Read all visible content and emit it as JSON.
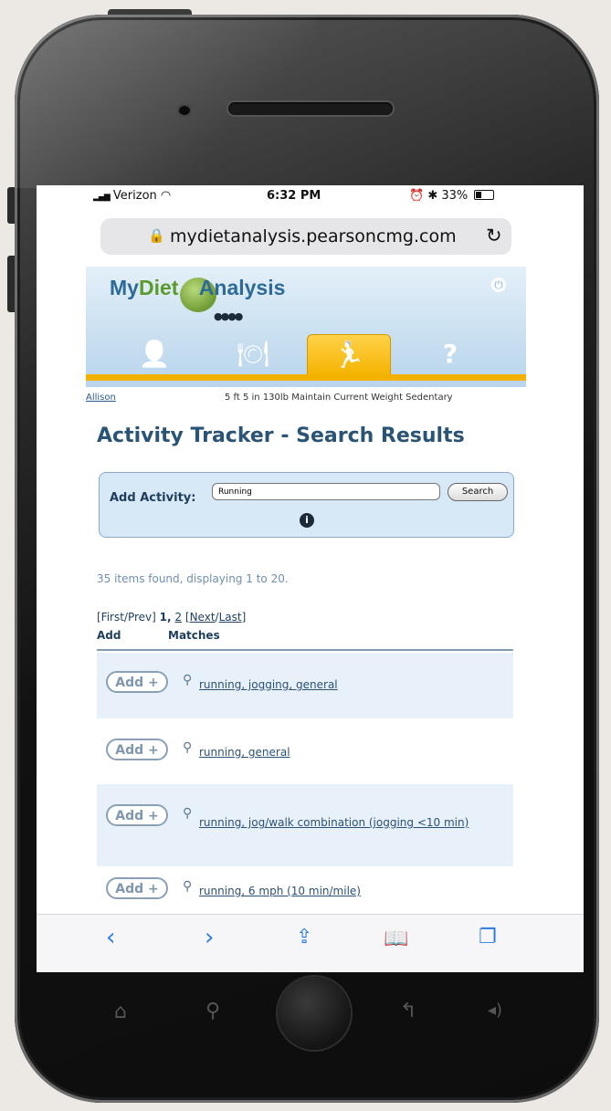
{
  "status_bar": {
    "carrier": "Verizon",
    "time": "6:32 PM",
    "battery": "33%"
  },
  "browser": {
    "url": "mydietanalysis.pearsoncmg.com"
  },
  "site": {
    "logo_my": "My",
    "logo_diet": "Diet",
    "logo_analysis": "Analysis",
    "tabs": [
      {
        "icon": "person-icon",
        "glyph": "👤"
      },
      {
        "icon": "plate-icon",
        "glyph": "🍽"
      },
      {
        "icon": "runner-icon",
        "glyph": "🏃"
      },
      {
        "icon": "help-icon",
        "glyph": "?"
      }
    ],
    "user_name": "Allison",
    "user_info": "5 ft 5 in  130lb  Maintain Current Weight  Sedentary"
  },
  "page": {
    "title": "Activity Tracker - Search Results",
    "add_activity_label": "Add Activity:",
    "search_value": "Running",
    "search_button": "Search",
    "items_found": "35 items found, displaying 1 to 20.",
    "pager": {
      "first_prev": "[First/Prev]",
      "page1": "1,",
      "page2": "2",
      "next": "Next",
      "last": "Last"
    },
    "col_add": "Add",
    "col_matches": "Matches",
    "add_label": "Add +",
    "results": [
      "running, jogging, general",
      "running, general",
      "running, jog/walk combination (jogging <10 min)",
      "running, 6 mph (10 min/mile)"
    ]
  },
  "colors": {
    "accent": "#f3b200",
    "title": "#2a5476",
    "ios_blue": "#2a7ce2"
  }
}
